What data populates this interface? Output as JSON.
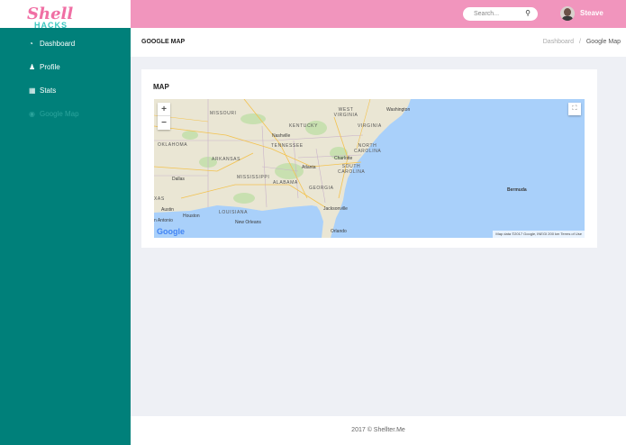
{
  "brand": {
    "logo_script": "Shell",
    "logo_sub": "HACKS"
  },
  "sidebar": {
    "items": [
      {
        "label": "Dashboard",
        "icon": "dashboard-icon"
      },
      {
        "label": "Profile",
        "icon": "user-icon"
      },
      {
        "label": "Stats",
        "icon": "table-icon"
      },
      {
        "label": "Google Map",
        "icon": "location-icon"
      }
    ]
  },
  "topbar": {
    "search_placeholder": "Search...",
    "user_name": "Steave"
  },
  "page": {
    "title": "GOOGLE MAP",
    "breadcrumb_home": "Dashboard",
    "breadcrumb_sep": "/",
    "breadcrumb_current": "Google Map"
  },
  "card": {
    "title": "MAP"
  },
  "map": {
    "labels": {
      "washington": "Washington",
      "missouri": "MISSOURI",
      "west_virginia": "WEST VIRGINIA",
      "virginia": "VIRGINIA",
      "kentucky": "KENTUCKY",
      "nashville": "Nashville",
      "oklahoma": "OKLAHOMA",
      "tennessee": "TENNESSEE",
      "north_carolina": "NORTH CAROLINA",
      "arkansas": "ARKANSAS",
      "charlotte": "Charlotte",
      "atlanta": "Atlanta",
      "south_carolina": "SOUTH CAROLINA",
      "mississippi": "MISSISSIPPI",
      "dallas": "Dallas",
      "alabama": "ALABAMA",
      "georgia": "GEORGIA",
      "bermuda": "Bermuda",
      "texas": "XAS",
      "jacksonville": "Jacksonville",
      "austin": "Austin",
      "louisiana": "LOUISIANA",
      "houston": "Houston",
      "san_antonio": "n Antonio",
      "new_orleans": "New Orleans",
      "orlando": "Orlando"
    },
    "zoom_in": "+",
    "zoom_out": "−",
    "google_logo": "Google",
    "attribution": "Map data ©2017 Google, INEGI   200 km   Terms of Use"
  },
  "footer": {
    "text": "2017 © Shellter.Me"
  },
  "colors": {
    "sidebar": "#00807a",
    "topbar": "#f195bd",
    "water": "#a9d0fa",
    "land": "#eae6d4"
  }
}
